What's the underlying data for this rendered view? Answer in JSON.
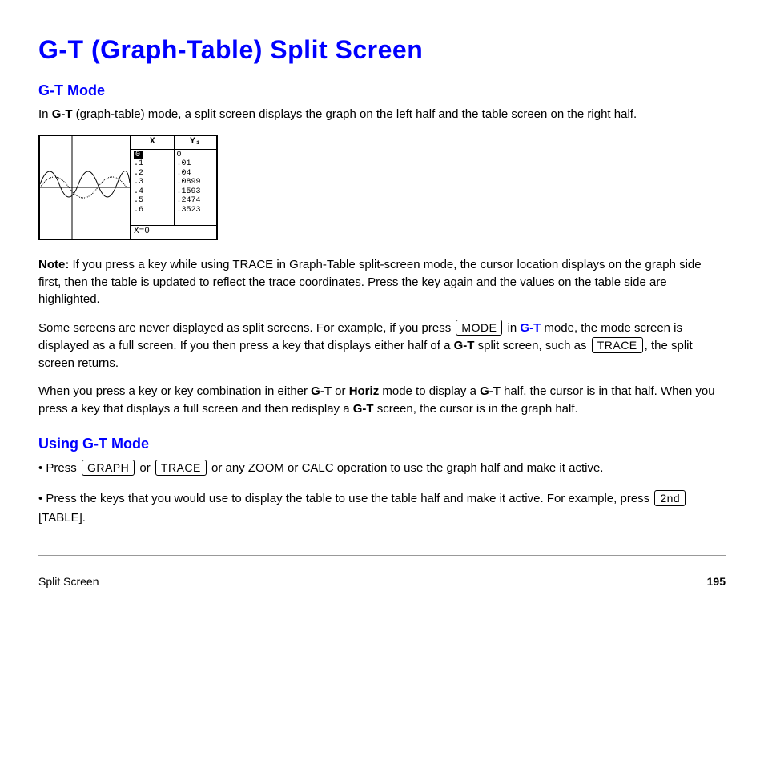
{
  "title": "G-T (Graph-Table) Split Screen",
  "subtitles": {
    "s1": "G-T Mode",
    "s2": "Using G-T Mode"
  },
  "para1_a": "In ",
  "para1_b": "G-T",
  "para1_c": " (graph-table) mode, a split screen displays the graph on the left half and the table screen on the right half.",
  "calc": {
    "hx": "X",
    "hy": "Y₁",
    "xcol": [
      "0",
      ".1",
      ".2",
      ".3",
      ".4",
      ".5",
      ".6"
    ],
    "ycol": [
      "0",
      ".01",
      ".04",
      ".0899",
      ".1593",
      ".2474",
      ".3523"
    ],
    "footer": "X=0"
  },
  "chart_data": {
    "type": "table",
    "columns": [
      "X",
      "Y1"
    ],
    "rows": [
      [
        0.0,
        0.0
      ],
      [
        0.1,
        0.01
      ],
      [
        0.2,
        0.04
      ],
      [
        0.3,
        0.0899
      ],
      [
        0.4,
        0.1593
      ],
      [
        0.5,
        0.2474
      ],
      [
        0.6,
        0.3523
      ]
    ]
  },
  "note_label": "Note:",
  "note_body": " If you press a key while using TRACE in Graph-Table split-screen mode, the cursor location displays on the graph side first, then the table is updated to reflect the trace coordinates. Press the key again and the values on the table side are highlighted.",
  "para2_a": "Some screens are never displayed as split screens. For example, if you press ",
  "mode_key": "MODE",
  "para2_b": " in ",
  "para2_c": " mode, the mode screen is displayed as a full screen. If you then press a key that displays either half of a ",
  "para2_d": " split screen, such as ",
  "trace_key": "TRACE",
  "para2_e": ", the split screen returns.",
  "para3_a": "When you press a key or key combination in either ",
  "para3_b": " or ",
  "para3_c": " mode to display a ",
  "para3_d": " half, the cursor is in that half. When you press a key that displays a full screen and then redisplay a ",
  "para3_e": " screen, the cursor is in the graph half.",
  "list": {
    "item1_a": "• Press ",
    "graph_key": "GRAPH",
    "item1_b": " or ",
    "item1_c": " or any ZOOM or CALC operation to use the graph half and make it active.",
    "item2_a": "• Press the keys that you would use to display the table to use the table half and make it active. For example, press ",
    "second_key": "2nd",
    "table_key": "TABLE",
    "item2_b": "."
  },
  "footer": {
    "left": "Split Screen",
    "right": "195"
  }
}
